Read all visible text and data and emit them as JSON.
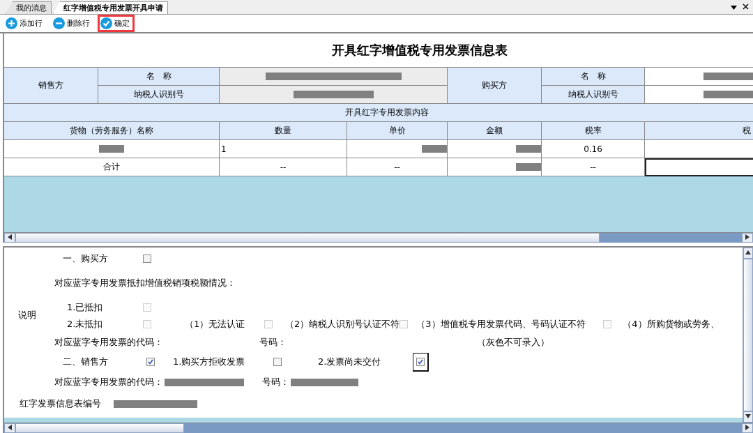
{
  "tabs": [
    {
      "label": "我的消息",
      "selected": false
    },
    {
      "label": "红字增值税专用发票开具申请",
      "selected": true
    }
  ],
  "toolbar": [
    {
      "label": "添加行",
      "kind": "add",
      "highlighted": false
    },
    {
      "label": "删除行",
      "kind": "remove",
      "highlighted": false
    },
    {
      "label": "确定",
      "kind": "confirm",
      "highlighted": true
    }
  ],
  "table": {
    "title": "开具红字增值税专用发票信息表",
    "seller": {
      "label": "销售方",
      "fields": [
        {
          "label": "名　称",
          "redacted": true
        },
        {
          "label": "纳税人识别号",
          "redacted": true
        }
      ]
    },
    "buyer": {
      "label": "购买方",
      "fields": [
        {
          "label": "名　称",
          "redacted": true
        },
        {
          "label": "纳税人识别号",
          "redacted": true
        }
      ]
    },
    "section_header": "开具红字专用发票内容",
    "columns": [
      "货物（劳务服务）名称",
      "数量",
      "单价",
      "金额",
      "税率",
      "税"
    ],
    "rows": [
      {
        "cells": [
          {
            "text": "",
            "redacted": true
          },
          {
            "text": "1",
            "redacted": false
          },
          {
            "text": "",
            "redacted": true
          },
          {
            "text": "",
            "redacted": true
          },
          {
            "text": "0.16",
            "redacted": false
          },
          {
            "text": "",
            "redacted": false
          }
        ]
      },
      {
        "cells": [
          {
            "text": "合计",
            "redacted": false
          },
          {
            "text": "--",
            "redacted": false
          },
          {
            "text": "--",
            "redacted": false
          },
          {
            "text": "",
            "redacted": true
          },
          {
            "text": "--",
            "redacted": false
          },
          {
            "text": "",
            "redacted": false,
            "focused": true
          }
        ]
      }
    ]
  },
  "form": {
    "side_label": "说明",
    "buyer": {
      "label": "一、购买方",
      "checked": false
    },
    "deduction_heading": "对应蓝字专用发票抵扣增值税销项税额情况：",
    "deducted": {
      "label": "1.已抵扣",
      "checked": false,
      "disabled": true
    },
    "not_deducted": {
      "label": "2.未抵扣",
      "checked": false,
      "disabled": true
    },
    "reasons": [
      {
        "label": "（1）无法认证",
        "checked": false,
        "disabled": true
      },
      {
        "label": "（2）纳税人识别号认证不符",
        "checked": false,
        "disabled": true
      },
      {
        "label": "（3）增值税专用发票代码、号码认证不符",
        "checked": false,
        "disabled": true
      }
    ],
    "reason_cut": "（4）所购货物或劳务、",
    "buyer_code_label": "对应蓝字专用发票的代码：",
    "buyer_number_label": "号码：",
    "gray_note": "（灰色不可录入）",
    "seller": {
      "label": "二、销售方",
      "checked": true
    },
    "seller_reasons": [
      {
        "label": "1.购买方拒收发票",
        "checked": false,
        "focused": false
      },
      {
        "label": "2.发票尚未交付",
        "checked": true,
        "focused": true
      }
    ],
    "seller_code": {
      "label": "对应蓝字专用发票的代码：",
      "redacted": true
    },
    "seller_number": {
      "label": "号码：",
      "redacted": true
    },
    "info_number": {
      "label": "红字发票信息表编号",
      "redacted": true
    }
  }
}
